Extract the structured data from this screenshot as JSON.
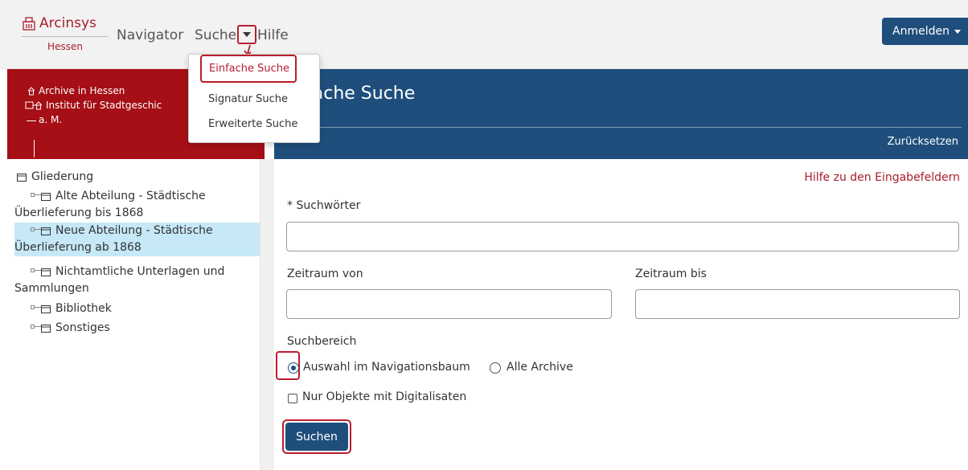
{
  "brand": {
    "name": "Arcinsys",
    "region": "Hessen"
  },
  "nav": {
    "navigator": "Navigator",
    "suche": "Suche",
    "hilfe": "Hilfe",
    "login": "Anmelden"
  },
  "dropdown": {
    "items": [
      "Einfache Suche",
      "Signatur Suche",
      "Erweiterte Suche"
    ],
    "active": "Einfache Suche"
  },
  "sidebar": {
    "header": {
      "archives": "Archive in Hessen",
      "institute": "Institut für Stadtgeschic",
      "institute_cont": "a. M."
    },
    "root": "Gliederung",
    "items": [
      {
        "line1": "Alte Abteilung - Städtische",
        "line2": "Überlieferung bis 1868",
        "selected": false
      },
      {
        "line1": "Neue Abteilung - Städtische",
        "line2": "Überlieferung ab 1868",
        "selected": true
      },
      {
        "line1": "Nichtamtliche Unterlagen und",
        "line2": "Sammlungen",
        "selected": false
      },
      {
        "line1": "Bibliothek",
        "line2": "",
        "selected": false
      },
      {
        "line1": "Sonstiges",
        "line2": "",
        "selected": false
      }
    ]
  },
  "main": {
    "title": "fache Suche",
    "reset": "Zurücksetzen",
    "help": "Hilfe zu den Eingabefeldern",
    "keywords_label": "* Suchwörter",
    "keywords_value": "",
    "from_label": "Zeitraum von",
    "from_value": "",
    "to_label": "Zeitraum bis",
    "to_value": "",
    "scope_label": "Suchbereich",
    "scope_options": [
      "Auswahl im Navigationsbaum",
      "Alle Archive"
    ],
    "scope_selected": "Auswahl im Navigationsbaum",
    "digital_only_label": "Nur Objekte mit Digitalisaten",
    "digital_only_checked": false,
    "search_button": "Suchen"
  },
  "colors": {
    "brand_red": "#a50f15",
    "primary_blue": "#1f4e7c",
    "highlight_red": "#b81e2e",
    "selected_row": "#c6e8f7"
  }
}
